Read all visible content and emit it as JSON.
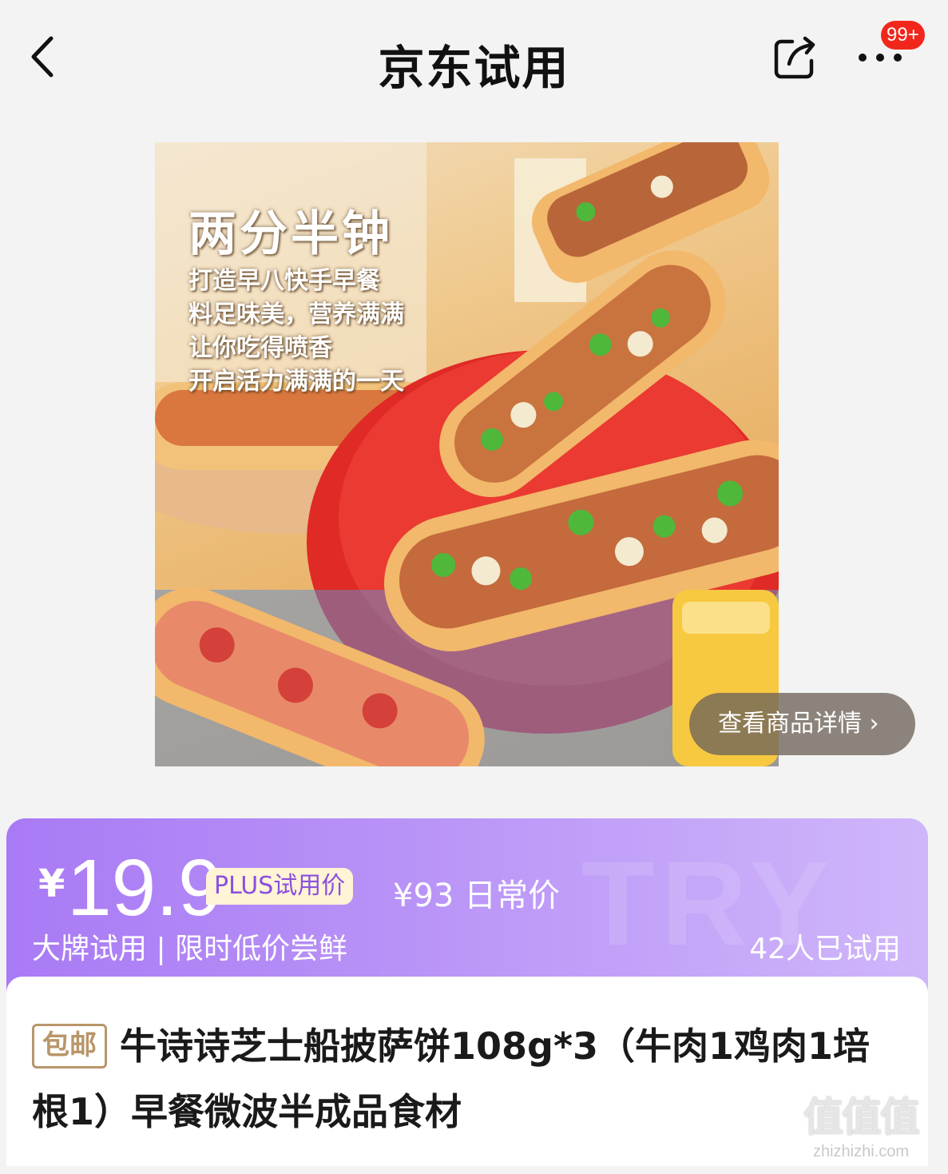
{
  "header": {
    "title": "京东试用",
    "badge": "99+"
  },
  "product_image": {
    "headline": "两分半钟",
    "lines": [
      "打造早八快手早餐",
      "料足味美，营养满满",
      "让你吃得喷香",
      "开启活力满满的一天"
    ],
    "detail_button": "查看商品详情 ›"
  },
  "price": {
    "currency": "¥",
    "value": "19.9",
    "plus_label": "PLUS试用价",
    "original": "¥93 日常价",
    "slogan": "大牌试用 | 限时低价尝鲜",
    "tried_count": "42人已试用",
    "watermark": "TRY",
    "colors": {
      "card_start": "#a97af5",
      "card_end": "#cfb6fa",
      "plus_text": "#8a4fe0"
    }
  },
  "product": {
    "shipping_tag": "包邮",
    "title": "牛诗诗芝士船披萨饼108g*3（牛肉1鸡肉1培根1）早餐微波半成品食材"
  },
  "watermark": {
    "logo": "值值值",
    "site": "zhizhizhi.com"
  }
}
